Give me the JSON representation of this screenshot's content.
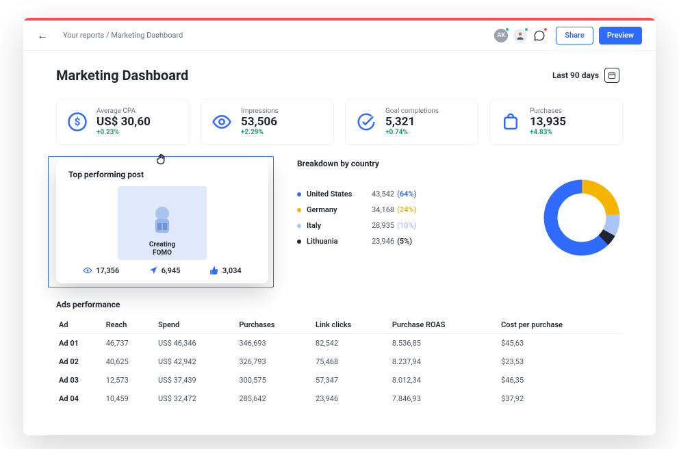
{
  "breadcrumb": "Your reports / Marketing Dashboard",
  "header": {
    "share_label": "Share",
    "preview_label": "Preview",
    "avatars": [
      {
        "initials": "AK",
        "bg": "#9aa1ac",
        "dot": "#24c76f"
      },
      {
        "initials": "",
        "bg": "#e9edf2",
        "dot": "#24c76f"
      }
    ]
  },
  "page_title": "Marketing Dashboard",
  "date_range": "Last 90 days",
  "kpis": [
    {
      "label": "Average CPA",
      "value": "US$ 30,60",
      "delta": "+0.23%",
      "color": "#2f6bff",
      "icon": "dollar"
    },
    {
      "label": "Impressions",
      "value": "53,506",
      "delta": "+2.29%",
      "color": "#2f6bff",
      "icon": "eye"
    },
    {
      "label": "Goal completions",
      "value": "5,321",
      "delta": "+0.74%",
      "color": "#2f6bff",
      "icon": "check"
    },
    {
      "label": "Purchases",
      "value": "13,935",
      "delta": "+4.83%",
      "color": "#2f6bff",
      "icon": "bag"
    }
  ],
  "top_post": {
    "heading": "Top performing post",
    "thumb_title_l1": "Creating",
    "thumb_title_l2": "FOMO",
    "stats": {
      "views": "17,356",
      "shares": "6,945",
      "likes": "3,034"
    }
  },
  "breakdown": {
    "heading": "Breakdown by country",
    "rows": [
      {
        "name": "United States",
        "value": "43,542",
        "pct": "(64%)",
        "color": "#2f6bff"
      },
      {
        "name": "Germany",
        "value": "34,168",
        "pct": "(24%)",
        "color": "#f5b400"
      },
      {
        "name": "Italy",
        "value": "28,935",
        "pct": "(10%)",
        "color": "#a9c4f5"
      },
      {
        "name": "Lithuania",
        "value": "23,946",
        "pct": "(5%)",
        "color": "#1e2530"
      }
    ]
  },
  "ads": {
    "heading": "Ads performance",
    "columns": [
      "Ad",
      "Reach",
      "Spend",
      "Purchases",
      "Link clicks",
      "Purchase ROAS",
      "Cost per purchase"
    ],
    "rows": [
      [
        "Ad 01",
        "46,737",
        "US$ 46,346",
        "346,693",
        "82,542",
        "8.536,85",
        "$45,63"
      ],
      [
        "Ad 02",
        "40,625",
        "US$ 42,942",
        "326,793",
        "75,468",
        "8.237,94",
        "$23,53"
      ],
      [
        "Ad 03",
        "12,573",
        "US$ 37,439",
        "300,575",
        "57,347",
        "8.012,34",
        "$46,35"
      ],
      [
        "Ad 04",
        "10,459",
        "US$ 32,472",
        "285,642",
        "23,946",
        "7.846,93",
        "$37,92"
      ]
    ]
  },
  "chart_data": {
    "type": "pie",
    "title": "Breakdown by country",
    "series": [
      {
        "name": "United States",
        "value": 64,
        "color": "#2f6bff"
      },
      {
        "name": "Germany",
        "value": 24,
        "color": "#f5b400"
      },
      {
        "name": "Italy",
        "value": 10,
        "color": "#a9c4f5"
      },
      {
        "name": "Lithuania",
        "value": 5,
        "color": "#1e2530"
      }
    ]
  },
  "colors": {
    "accent": "#2f6bff",
    "positive": "#059669"
  }
}
